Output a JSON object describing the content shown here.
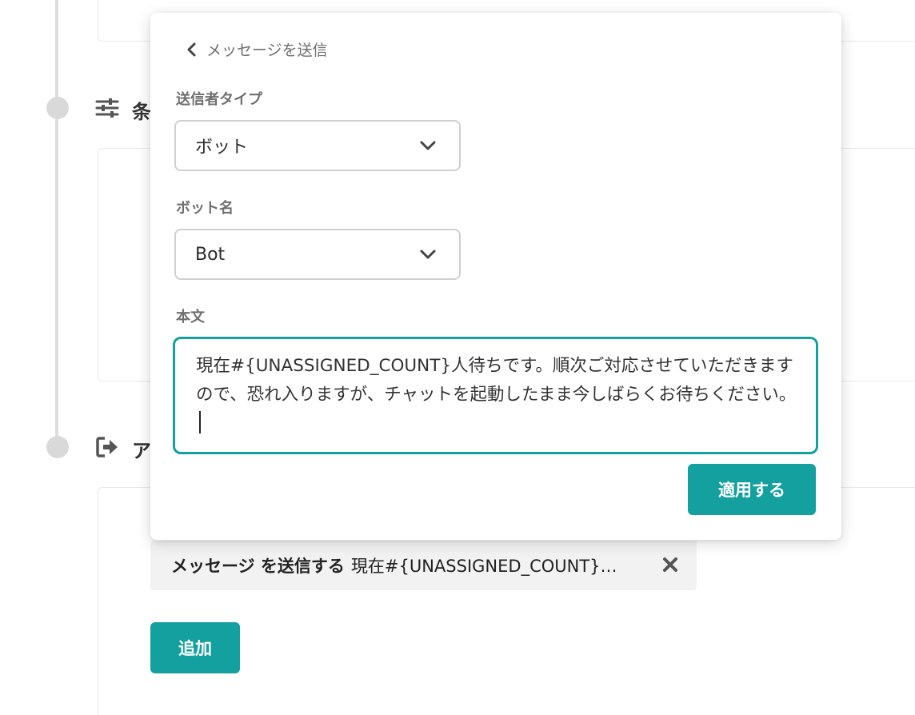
{
  "background": {
    "section_condition_title": "条",
    "section_action_title": "ア",
    "action_chip": {
      "label": "メッセージ を送信する",
      "preview": "現在#{UNASSIGNED_COUNT}人待ちです。順次ご対応させていただきますので、恐れ入りますが、チャットを起動したまま今しばらくお待ちください。"
    },
    "add_button_label": "追加"
  },
  "popover": {
    "back_label": "メッセージを送信",
    "sender_type": {
      "label": "送信者タイプ",
      "value": "ボット"
    },
    "bot_name": {
      "label": "ボット名",
      "value": "Bot"
    },
    "body": {
      "label": "本文",
      "value": "現在#{UNASSIGNED_COUNT}人待ちです。順次ご対応させていただきますので、恐れ入りますが、チャットを起動したまま今しばらくお待ちください。"
    },
    "apply_button_label": "適用する"
  },
  "colors": {
    "accent": "#13a09e",
    "timeline": "#dcdcdc"
  },
  "icons": [
    "sliders-icon",
    "sign-out-icon",
    "chevron-left-icon",
    "chevron-down-icon",
    "close-icon"
  ]
}
